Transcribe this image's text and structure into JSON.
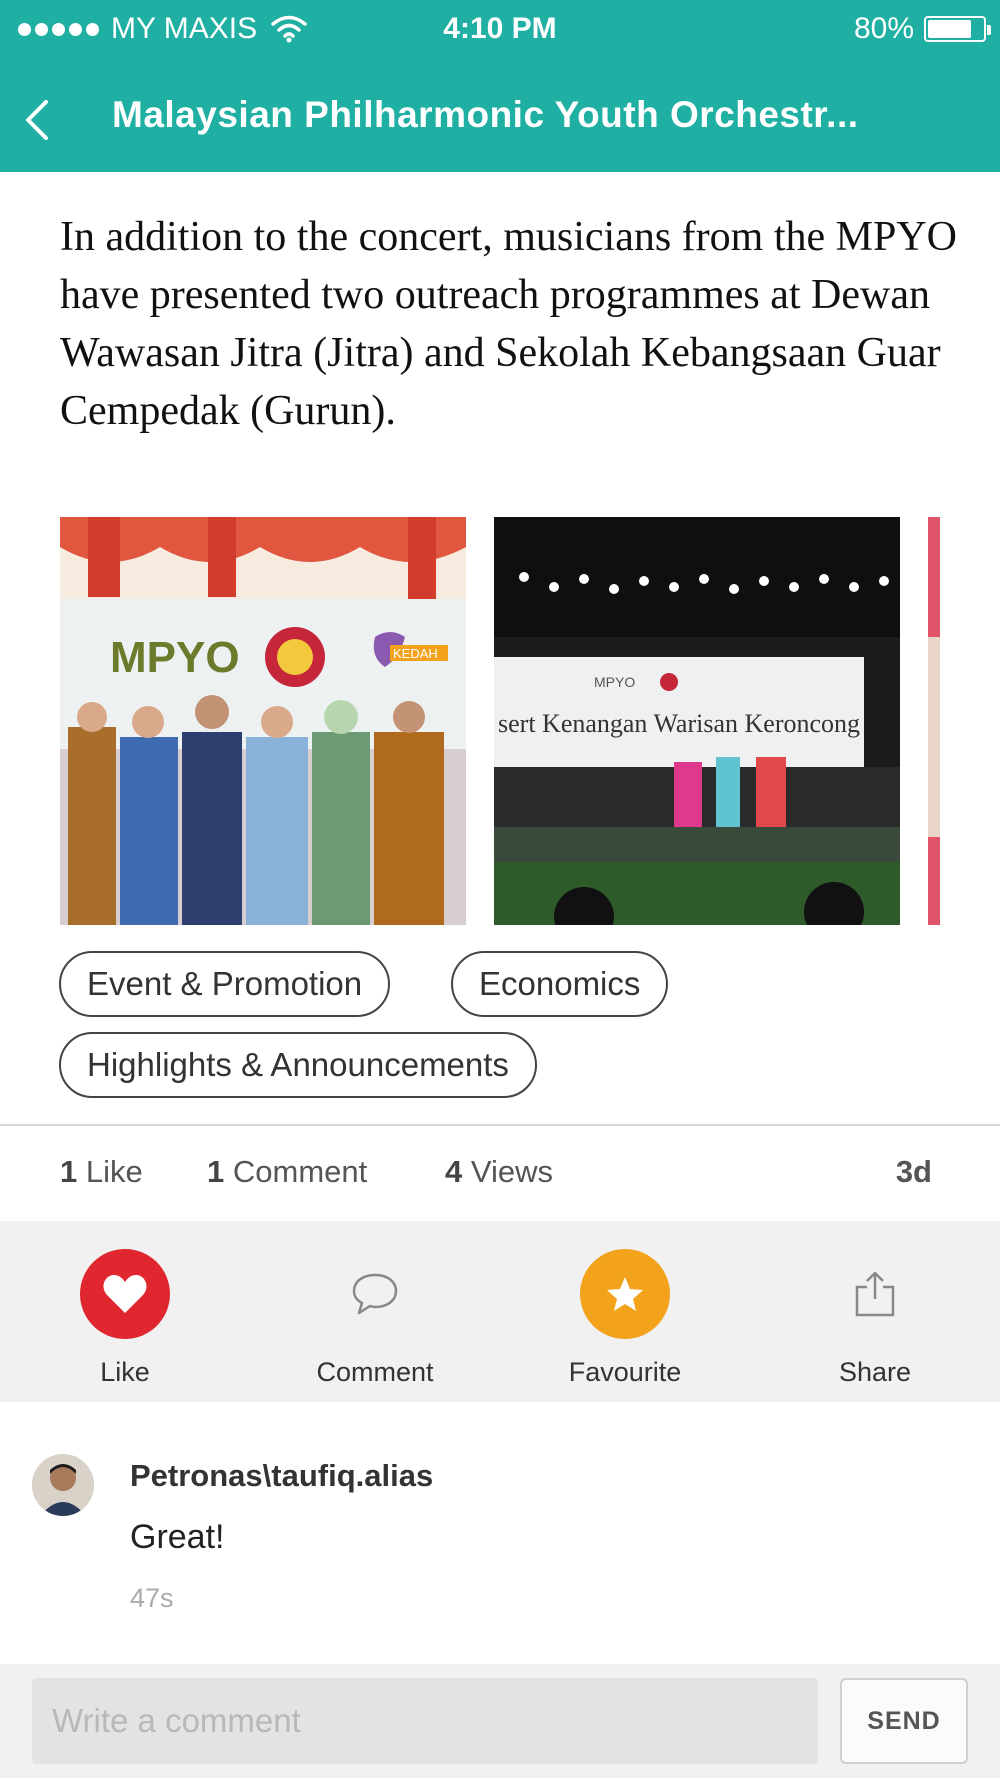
{
  "status_bar": {
    "carrier": "MY MAXIS",
    "time": "4:10 PM",
    "battery": "80%",
    "battery_level": 0.8
  },
  "nav": {
    "back_icon": "chevron-left-icon",
    "title": "Malaysian Philharmonic Youth Orchestr..."
  },
  "post": {
    "body": "In addition to the concert, musicians from the MPYO have presented two outreach programmes at Dewan Wawasan Jitra (Jitra) and Sekolah Kebangsaan Guar Cempedak (Gurun).",
    "photos": [
      {
        "banner_text": "MPYO",
        "logo_text": "KEDAH"
      },
      {
        "banner_text": "sert Kenangan Warisan Keroncong",
        "logo_text": "MPYO"
      }
    ],
    "tags": [
      "Event & Promotion",
      "Economics",
      "Highlights & Announcements"
    ]
  },
  "stats": {
    "likes_count": "1",
    "likes_label": "Like",
    "comments_count": "1",
    "comments_label": "Comment",
    "views_count": "4",
    "views_label": "Views",
    "age": "3d"
  },
  "actions": [
    {
      "label": "Like",
      "icon": "heart-icon",
      "color": "#e0262e"
    },
    {
      "label": "Comment",
      "icon": "speech-bubble-icon"
    },
    {
      "label": "Favourite",
      "icon": "star-icon",
      "color": "#f3a21c"
    },
    {
      "label": "Share",
      "icon": "share-icon"
    }
  ],
  "comments": [
    {
      "author": "Petronas\\taufiq.alias",
      "text": "Great!",
      "time": "47s"
    }
  ],
  "composer": {
    "placeholder": "Write a comment",
    "send_label": "SEND"
  },
  "colors": {
    "accent": "#1fb0a3",
    "like": "#e0262e",
    "favourite": "#f3a21c"
  }
}
